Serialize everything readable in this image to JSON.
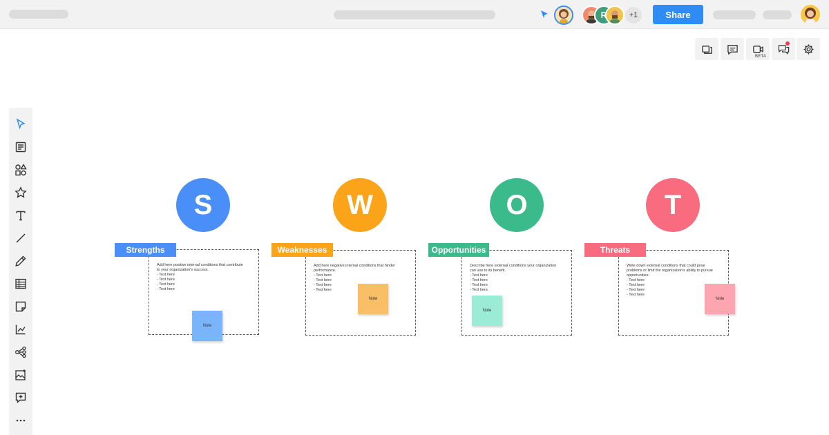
{
  "header": {
    "share_label": "Share",
    "collaborator_initial": "R",
    "more_collaborators": "+1"
  },
  "right_tools": {
    "beta_label": "BETA",
    "icons": [
      "frames-icon",
      "comment-icon",
      "video-icon",
      "chat-icon",
      "settings-icon"
    ]
  },
  "left_tools": [
    "select-icon",
    "template-icon",
    "shapes-icon",
    "star-icon",
    "text-icon",
    "line-icon",
    "pen-icon",
    "table-icon",
    "sticky-note-icon",
    "chart-icon",
    "mindmap-icon",
    "image-icon",
    "add-frame-icon",
    "more-icon"
  ],
  "swot": [
    {
      "letter": "S",
      "title": "Strengths",
      "color": "#4a8ef8",
      "note_color": "#7ab4fb",
      "description": [
        "Add here positive internal conditions that contribute",
        "to your organization's success."
      ],
      "items": [
        "- Text here",
        "- Text here",
        "- Text here",
        "- Text here"
      ],
      "note": "Note"
    },
    {
      "letter": "W",
      "title": "Weaknesses",
      "color": "#fba41a",
      "note_color": "#f9bf67",
      "description": [
        "Add here negative internal conditions that hinder",
        "performance."
      ],
      "items": [
        "- Text here",
        "- Text here",
        "- Text here",
        "- Text here"
      ],
      "note": "Note"
    },
    {
      "letter": "O",
      "title": "Opportunities",
      "color": "#3bbb8c",
      "note_color": "#9aecd6",
      "description": [
        "Describe here external conditions your organization",
        "can use to its benefit."
      ],
      "items": [
        "- Text here",
        "- Text here",
        "- Text here",
        "- Text here"
      ],
      "note": "Note"
    },
    {
      "letter": "T",
      "title": "Threats",
      "color": "#f96c80",
      "note_color": "#fda5b1",
      "description": [
        "Write down external conditions that could pose",
        "problems or limit the organization's ability to pursue",
        "opportunities."
      ],
      "items": [
        "- Text here",
        "- Text here",
        "- Text here",
        "- Text here"
      ],
      "note": "Note"
    }
  ]
}
